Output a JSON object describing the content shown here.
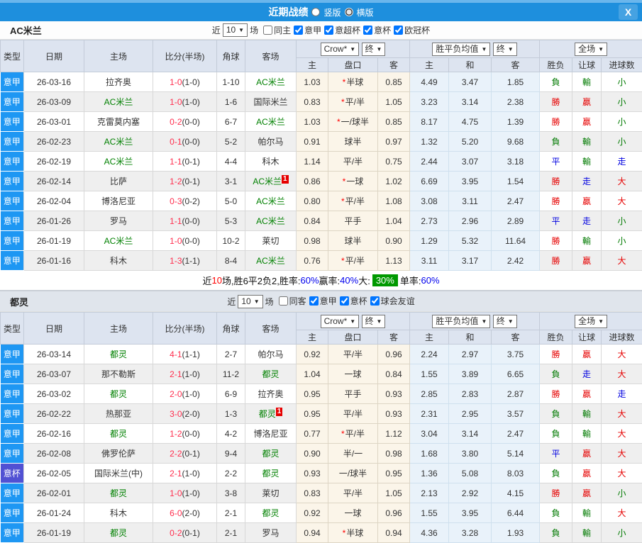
{
  "colors": {
    "accent": "#1e8fdd",
    "league_blue": "#1e97f3",
    "cup_purple": "#5151d3",
    "team_green": "#008000",
    "score_red": "#ff2d4d",
    "summary_green": "#009900"
  },
  "cup_label": "意杯",
  "result_color_map": {
    "勝": "red",
    "負": "green",
    "平": "blue",
    "贏": "red",
    "輸": "green",
    "走": "blue",
    "大": "red",
    "小": "green"
  },
  "titlebar": {
    "title": "近期战绩",
    "radio1_label": "竖版",
    "radio2_label": "横版",
    "selected_layout": "横版",
    "close_label": "X"
  },
  "sections": [
    {
      "team": "AC米兰",
      "filter": {
        "near": "近",
        "games": "10",
        "suffix": "场",
        "checkboxes": [
          {
            "label": "同主",
            "checked": false
          },
          {
            "label": "意甲",
            "checked": true
          },
          {
            "label": "意超杯",
            "checked": true
          },
          {
            "label": "意杯",
            "checked": true
          },
          {
            "label": "欧冠杯",
            "checked": true
          }
        ]
      },
      "selects": {
        "company": "Crow*",
        "final1": "终",
        "avg": "胜平负均值",
        "final2": "终",
        "scope": "全场"
      },
      "columns": {
        "type": "类型",
        "date": "日期",
        "home": "主场",
        "score": "比分(半场)",
        "corners": "角球",
        "away": "客场",
        "odds_home": "主",
        "handicap": "盘口",
        "odds_away": "客",
        "avg_home": "主",
        "avg_draw": "和",
        "avg_away": "客",
        "result": "胜负",
        "let_goal": "让球",
        "goals": "进球数"
      },
      "rows": [
        {
          "type": "意甲",
          "date": "26-03-16",
          "home": "拉齐奥",
          "home_team": false,
          "score": "1-0",
          "half": "(1-0)",
          "corners": "1-10",
          "away": "AC米兰",
          "away_team": true,
          "badge": null,
          "o1": "1.03",
          "star": true,
          "hc": "半球",
          "o2": "0.85",
          "a1": "4.49",
          "a2": "3.47",
          "a3": "1.85",
          "rs": "負",
          "lg": "輸",
          "gs": "小"
        },
        {
          "type": "意甲",
          "date": "26-03-09",
          "home": "AC米兰",
          "home_team": true,
          "score": "1-0",
          "half": "(1-0)",
          "corners": "1-6",
          "away": "国际米兰",
          "away_team": false,
          "badge": null,
          "o1": "0.83",
          "star": true,
          "hc": "平/半",
          "o2": "1.05",
          "a1": "3.23",
          "a2": "3.14",
          "a3": "2.38",
          "rs": "勝",
          "lg": "贏",
          "gs": "小"
        },
        {
          "type": "意甲",
          "date": "26-03-01",
          "home": "克雷莫内塞",
          "home_team": false,
          "score": "0-2",
          "half": "(0-0)",
          "corners": "6-7",
          "away": "AC米兰",
          "away_team": true,
          "badge": null,
          "o1": "1.03",
          "star": true,
          "hc": "一/球半",
          "o2": "0.85",
          "a1": "8.17",
          "a2": "4.75",
          "a3": "1.39",
          "rs": "勝",
          "lg": "贏",
          "gs": "小"
        },
        {
          "type": "意甲",
          "date": "26-02-23",
          "home": "AC米兰",
          "home_team": true,
          "score": "0-1",
          "half": "(0-0)",
          "corners": "5-2",
          "away": "帕尔马",
          "away_team": false,
          "badge": null,
          "o1": "0.91",
          "star": false,
          "hc": "球半",
          "o2": "0.97",
          "a1": "1.32",
          "a2": "5.20",
          "a3": "9.68",
          "rs": "負",
          "lg": "輸",
          "gs": "小"
        },
        {
          "type": "意甲",
          "date": "26-02-19",
          "home": "AC米兰",
          "home_team": true,
          "score": "1-1",
          "half": "(0-1)",
          "corners": "4-4",
          "away": "科木",
          "away_team": false,
          "badge": null,
          "o1": "1.14",
          "star": false,
          "hc": "平/半",
          "o2": "0.75",
          "a1": "2.44",
          "a2": "3.07",
          "a3": "3.18",
          "rs": "平",
          "lg": "輸",
          "gs": "走"
        },
        {
          "type": "意甲",
          "date": "26-02-14",
          "home": "比萨",
          "home_team": false,
          "score": "1-2",
          "half": "(0-1)",
          "corners": "3-1",
          "away": "AC米兰",
          "away_team": true,
          "badge": "1",
          "o1": "0.86",
          "star": true,
          "hc": "一球",
          "o2": "1.02",
          "a1": "6.69",
          "a2": "3.95",
          "a3": "1.54",
          "rs": "勝",
          "lg": "走",
          "gs": "大"
        },
        {
          "type": "意甲",
          "date": "26-02-04",
          "home": "博洛尼亚",
          "home_team": false,
          "score": "0-3",
          "half": "(0-2)",
          "corners": "5-0",
          "away": "AC米兰",
          "away_team": true,
          "badge": null,
          "o1": "0.80",
          "star": true,
          "hc": "平/半",
          "o2": "1.08",
          "a1": "3.08",
          "a2": "3.11",
          "a3": "2.47",
          "rs": "勝",
          "lg": "贏",
          "gs": "大"
        },
        {
          "type": "意甲",
          "date": "26-01-26",
          "home": "罗马",
          "home_team": false,
          "score": "1-1",
          "half": "(0-0)",
          "corners": "5-3",
          "away": "AC米兰",
          "away_team": true,
          "badge": null,
          "o1": "0.84",
          "star": false,
          "hc": "平手",
          "o2": "1.04",
          "a1": "2.73",
          "a2": "2.96",
          "a3": "2.89",
          "rs": "平",
          "lg": "走",
          "gs": "小"
        },
        {
          "type": "意甲",
          "date": "26-01-19",
          "home": "AC米兰",
          "home_team": true,
          "score": "1-0",
          "half": "(0-0)",
          "corners": "10-2",
          "away": "莱切",
          "away_team": false,
          "badge": null,
          "o1": "0.98",
          "star": false,
          "hc": "球半",
          "o2": "0.90",
          "a1": "1.29",
          "a2": "5.32",
          "a3": "11.64",
          "rs": "勝",
          "lg": "輸",
          "gs": "小"
        },
        {
          "type": "意甲",
          "date": "26-01-16",
          "home": "科木",
          "home_team": false,
          "score": "1-3",
          "half": "(1-1)",
          "corners": "8-4",
          "away": "AC米兰",
          "away_team": true,
          "badge": null,
          "o1": "0.76",
          "star": true,
          "hc": "平/半",
          "o2": "1.13",
          "a1": "3.11",
          "a2": "3.17",
          "a3": "2.42",
          "rs": "勝",
          "lg": "贏",
          "gs": "大"
        }
      ],
      "summary_parts": [
        {
          "t": "近",
          "c": "black"
        },
        {
          "t": "10",
          "c": "red"
        },
        {
          "t": "场,胜6平2负2, ",
          "c": "black"
        },
        {
          "t": "胜率:",
          "c": "black"
        },
        {
          "t": "60%",
          "c": "blue"
        },
        {
          "t": " 赢率:",
          "c": "black"
        },
        {
          "t": "40%",
          "c": "blue"
        },
        {
          "t": " 大: ",
          "c": "black"
        },
        {
          "t": "30%",
          "c": "greenbox"
        },
        {
          "t": " 单率:",
          "c": "black"
        },
        {
          "t": "60%",
          "c": "blue"
        }
      ],
      "shaded": false
    },
    {
      "team": "都灵",
      "filter": {
        "near": "近",
        "games": "10",
        "suffix": "场",
        "checkboxes": [
          {
            "label": "同客",
            "checked": false
          },
          {
            "label": "意甲",
            "checked": true
          },
          {
            "label": "意杯",
            "checked": true
          },
          {
            "label": "球会友谊",
            "checked": true
          }
        ]
      },
      "selects": {
        "company": "Crow*",
        "final1": "终",
        "avg": "胜平负均值",
        "final2": "终",
        "scope": "全场"
      },
      "columns": {
        "type": "类型",
        "date": "日期",
        "home": "主场",
        "score": "比分(半场)",
        "corners": "角球",
        "away": "客场",
        "odds_home": "主",
        "handicap": "盘口",
        "odds_away": "客",
        "avg_home": "主",
        "avg_draw": "和",
        "avg_away": "客",
        "result": "胜负",
        "let_goal": "让球",
        "goals": "进球数"
      },
      "rows": [
        {
          "type": "意甲",
          "date": "26-03-14",
          "home": "都灵",
          "home_team": true,
          "score": "4-1",
          "half": "(1-1)",
          "corners": "2-7",
          "away": "帕尔马",
          "away_team": false,
          "badge": null,
          "o1": "0.92",
          "star": false,
          "hc": "平/半",
          "o2": "0.96",
          "a1": "2.24",
          "a2": "2.97",
          "a3": "3.75",
          "rs": "勝",
          "lg": "贏",
          "gs": "大"
        },
        {
          "type": "意甲",
          "date": "26-03-07",
          "home": "那不勒斯",
          "home_team": false,
          "score": "2-1",
          "half": "(1-0)",
          "corners": "11-2",
          "away": "都灵",
          "away_team": true,
          "badge": null,
          "o1": "1.04",
          "star": false,
          "hc": "一球",
          "o2": "0.84",
          "a1": "1.55",
          "a2": "3.89",
          "a3": "6.65",
          "rs": "負",
          "lg": "走",
          "gs": "大"
        },
        {
          "type": "意甲",
          "date": "26-03-02",
          "home": "都灵",
          "home_team": true,
          "score": "2-0",
          "half": "(1-0)",
          "corners": "6-9",
          "away": "拉齐奥",
          "away_team": false,
          "badge": null,
          "o1": "0.95",
          "star": false,
          "hc": "平手",
          "o2": "0.93",
          "a1": "2.85",
          "a2": "2.83",
          "a3": "2.87",
          "rs": "勝",
          "lg": "贏",
          "gs": "走"
        },
        {
          "type": "意甲",
          "date": "26-02-22",
          "home": "热那亚",
          "home_team": false,
          "score": "3-0",
          "half": "(2-0)",
          "corners": "1-3",
          "away": "都灵",
          "away_team": true,
          "badge": "1",
          "o1": "0.95",
          "star": false,
          "hc": "平/半",
          "o2": "0.93",
          "a1": "2.31",
          "a2": "2.95",
          "a3": "3.57",
          "rs": "負",
          "lg": "輸",
          "gs": "大"
        },
        {
          "type": "意甲",
          "date": "26-02-16",
          "home": "都灵",
          "home_team": true,
          "score": "1-2",
          "half": "(0-0)",
          "corners": "4-2",
          "away": "博洛尼亚",
          "away_team": false,
          "badge": null,
          "o1": "0.77",
          "star": true,
          "hc": "平/半",
          "o2": "1.12",
          "a1": "3.04",
          "a2": "3.14",
          "a3": "2.47",
          "rs": "負",
          "lg": "輸",
          "gs": "大"
        },
        {
          "type": "意甲",
          "date": "26-02-08",
          "home": "佛罗伦萨",
          "home_team": false,
          "score": "2-2",
          "half": "(0-1)",
          "corners": "9-4",
          "away": "都灵",
          "away_team": true,
          "badge": null,
          "o1": "0.90",
          "star": false,
          "hc": "半/一",
          "o2": "0.98",
          "a1": "1.68",
          "a2": "3.80",
          "a3": "5.14",
          "rs": "平",
          "lg": "贏",
          "gs": "大"
        },
        {
          "type": "意杯",
          "date": "26-02-05",
          "home": "国际米兰(中)",
          "home_team": false,
          "score": "2-1",
          "half": "(1-0)",
          "corners": "2-2",
          "away": "都灵",
          "away_team": true,
          "badge": null,
          "o1": "0.93",
          "star": false,
          "hc": "一/球半",
          "o2": "0.95",
          "a1": "1.36",
          "a2": "5.08",
          "a3": "8.03",
          "rs": "負",
          "lg": "贏",
          "gs": "大"
        },
        {
          "type": "意甲",
          "date": "26-02-01",
          "home": "都灵",
          "home_team": true,
          "score": "1-0",
          "half": "(1-0)",
          "corners": "3-8",
          "away": "莱切",
          "away_team": false,
          "badge": null,
          "o1": "0.83",
          "star": false,
          "hc": "平/半",
          "o2": "1.05",
          "a1": "2.13",
          "a2": "2.92",
          "a3": "4.15",
          "rs": "勝",
          "lg": "贏",
          "gs": "小"
        },
        {
          "type": "意甲",
          "date": "26-01-24",
          "home": "科木",
          "home_team": false,
          "score": "6-0",
          "half": "(2-0)",
          "corners": "2-1",
          "away": "都灵",
          "away_team": true,
          "badge": null,
          "o1": "0.92",
          "star": false,
          "hc": "一球",
          "o2": "0.96",
          "a1": "1.55",
          "a2": "3.95",
          "a3": "6.44",
          "rs": "負",
          "lg": "輸",
          "gs": "大"
        },
        {
          "type": "意甲",
          "date": "26-01-19",
          "home": "都灵",
          "home_team": true,
          "score": "0-2",
          "half": "(0-1)",
          "corners": "2-1",
          "away": "罗马",
          "away_team": false,
          "badge": null,
          "o1": "0.94",
          "star": true,
          "hc": "半球",
          "o2": "0.94",
          "a1": "4.36",
          "a2": "3.28",
          "a3": "1.93",
          "rs": "負",
          "lg": "輸",
          "gs": "小"
        }
      ],
      "summary_parts": null,
      "shaded": true
    }
  ]
}
